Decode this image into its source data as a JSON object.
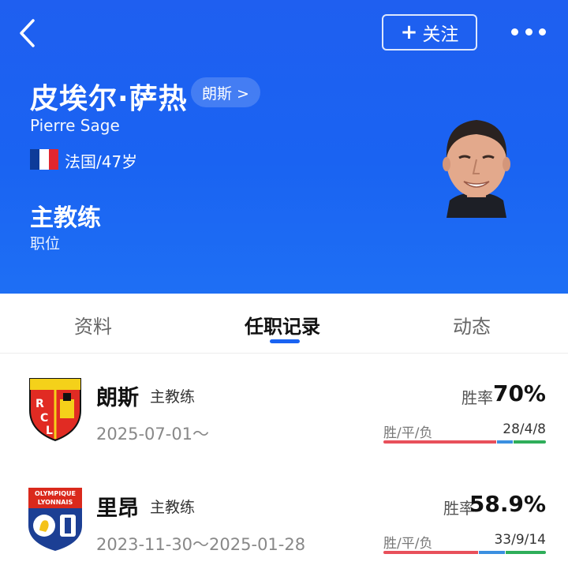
{
  "header": {
    "follow_label": "关注",
    "name_cn": "皮埃尔·萨热",
    "club_tag": "朗斯 >",
    "name_en": "Pierre Sage",
    "nationality_age": "法国/47岁",
    "position": "主教练",
    "position_label": "职位",
    "colors": {
      "background": "#1a63f2"
    },
    "flag_colors": [
      "#0d3b99",
      "#ffffff",
      "#e1262f"
    ]
  },
  "tabs": [
    {
      "label": "资料",
      "active": false
    },
    {
      "label": "任职记录",
      "active": true
    },
    {
      "label": "动态",
      "active": false
    }
  ],
  "records": [
    {
      "club": "朗斯",
      "role": "主教练",
      "period": "2025-07-01～",
      "win_rate_label": "胜率",
      "win_rate": "70%",
      "wdl_label": "胜/平/负",
      "wdl": "28/4/8",
      "wins": 28,
      "draws": 4,
      "losses": 8
    },
    {
      "club": "里昂",
      "role": "主教练",
      "period": "2023-11-30～2025-01-28",
      "win_rate_label": "胜率",
      "win_rate": "58.9%",
      "wdl_label": "胜/平/负",
      "wdl": "33/9/14",
      "wins": 33,
      "draws": 9,
      "losses": 14
    }
  ]
}
